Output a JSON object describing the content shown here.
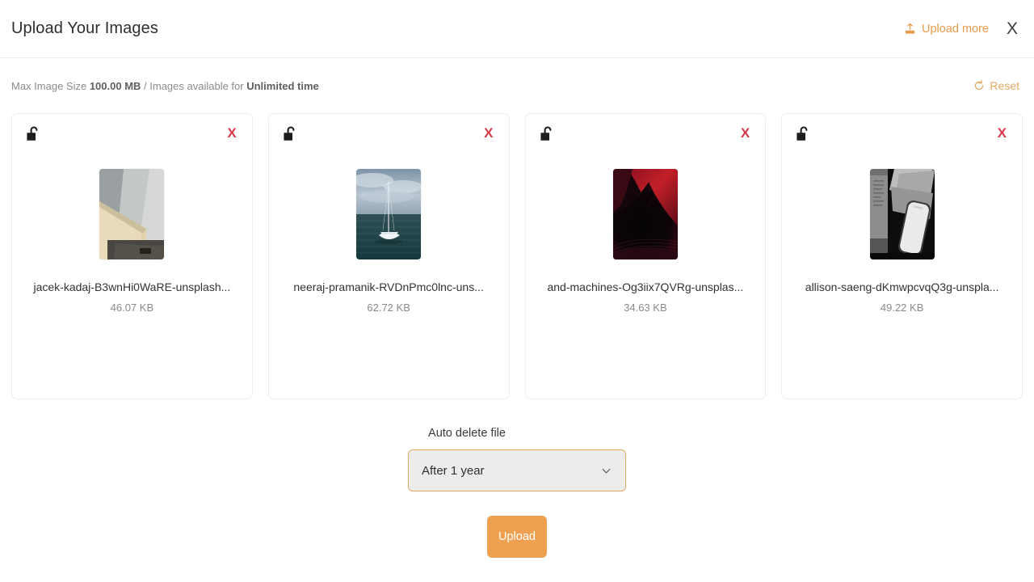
{
  "header": {
    "title": "Upload Your Images",
    "upload_more_label": "Upload more",
    "upload_more_icon": "upload-icon",
    "close_icon": "close-icon",
    "close_label": "X",
    "accent_color": "#e89b4c"
  },
  "info": {
    "prefix": "Max Image Size ",
    "max_size": "100.00 MB",
    "middle": " / Images available for ",
    "availability": "Unlimited time",
    "reset_label": "Reset",
    "reset_icon": "refresh-icon",
    "reset_color": "#e3a85f"
  },
  "cards": [
    {
      "lock_icon": "unlocked-padlock-icon",
      "remove_icon": "close-icon",
      "remove_label": "X",
      "file_name": "jacek-kadaj-B3wnHi0WaRE-unsplash...",
      "file_size": "46.07 KB",
      "thumb": "photo-wood-and-stone-surfaces"
    },
    {
      "lock_icon": "unlocked-padlock-icon",
      "remove_icon": "close-icon",
      "remove_label": "X",
      "file_name": "neeraj-pramanik-RVDnPmc0lnc-uns...",
      "file_size": "62.72 KB",
      "thumb": "photo-sailboat-on-sea"
    },
    {
      "lock_icon": "unlocked-padlock-icon",
      "remove_icon": "close-icon",
      "remove_label": "X",
      "file_name": "and-machines-Og3iix7QVRg-unsplas...",
      "file_size": "34.63 KB",
      "thumb": "photo-dark-red-abstract-waves"
    },
    {
      "lock_icon": "unlocked-padlock-icon",
      "remove_icon": "close-icon",
      "remove_label": "X",
      "file_name": "allison-saeng-dKmwpcvqQ3g-unspla...",
      "file_size": "49.22 KB",
      "thumb": "photo-grayscale-phone-on-papers"
    }
  ],
  "form": {
    "auto_delete_label": "Auto delete file",
    "auto_delete_value": "After 1 year",
    "chevron_icon": "chevron-down-icon",
    "upload_button_label": "Upload",
    "upload_button_color": "#efa051",
    "select_border_color": "#e2a960"
  }
}
